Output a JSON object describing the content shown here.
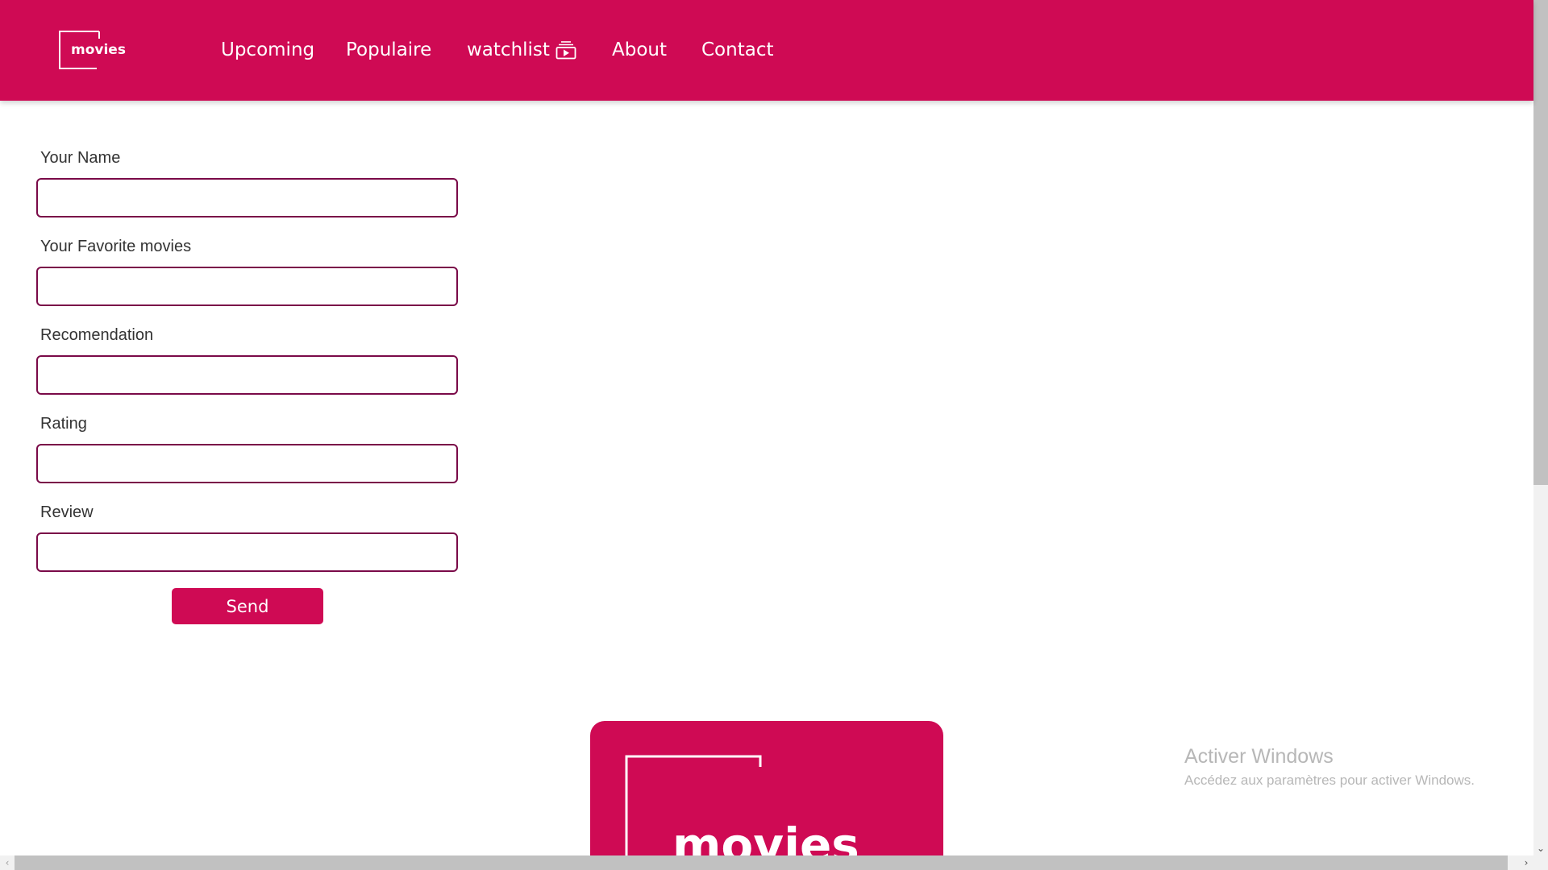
{
  "brand": {
    "logo_text": "movies",
    "accent_color": "#cf0a54",
    "input_border_color": "#7a0a48"
  },
  "nav": {
    "items": [
      {
        "label": "Upcoming"
      },
      {
        "label": "Populaire"
      },
      {
        "label": "watchlist",
        "icon": "playlist-play-icon"
      },
      {
        "label": "About"
      },
      {
        "label": "Contact"
      }
    ]
  },
  "form": {
    "fields": [
      {
        "label": "Your Name",
        "value": ""
      },
      {
        "label": "Your Favorite movies",
        "value": ""
      },
      {
        "label": "Recomendation",
        "value": ""
      },
      {
        "label": "Rating",
        "value": ""
      },
      {
        "label": "Review",
        "value": ""
      }
    ],
    "submit_label": "Send"
  },
  "footer": {
    "logo_text": "movies"
  },
  "windows_watermark": {
    "title": "Activer Windows",
    "subtitle": "Accédez aux paramètres pour activer Windows."
  },
  "scrollbars": {
    "arrow_up": "",
    "arrow_down": "⌄",
    "arrow_left": "‹",
    "arrow_right": "›"
  }
}
